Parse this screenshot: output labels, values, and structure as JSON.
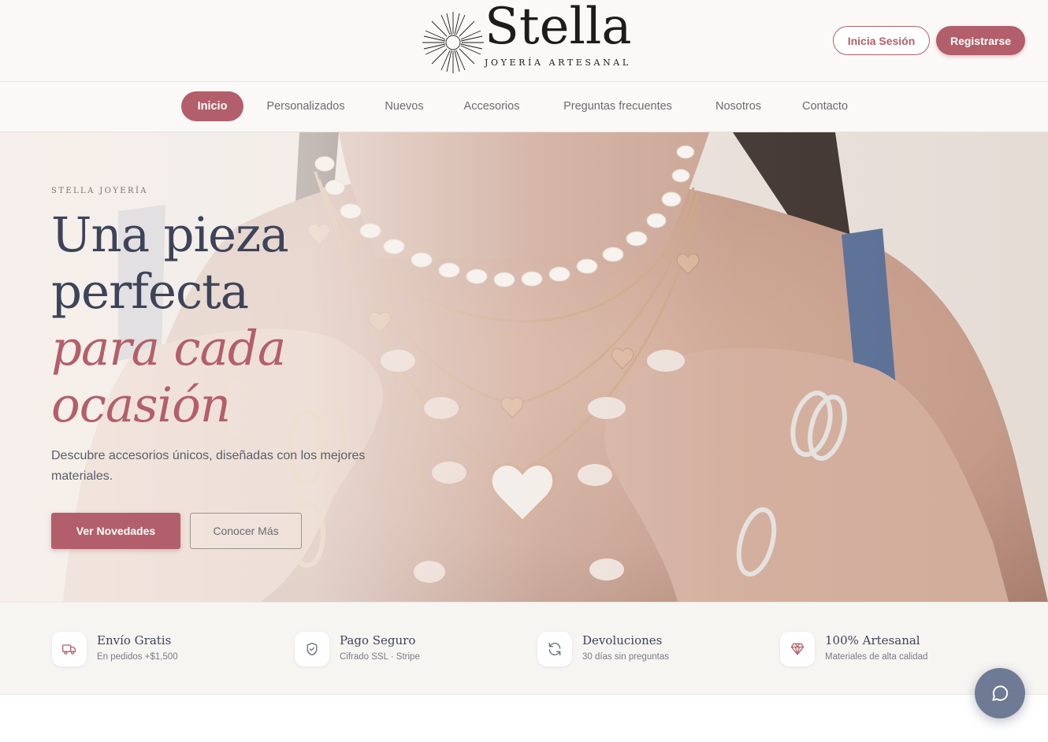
{
  "brand": {
    "name": "Stella",
    "tagline": "JOYERÍA ARTESANAL"
  },
  "header": {
    "login_label": "Inicia Sesión",
    "register_label": "Registrarse"
  },
  "nav": {
    "items": [
      {
        "label": "Inicio",
        "active": true
      },
      {
        "label": "Personalizados",
        "active": false
      },
      {
        "label": "Nuevos",
        "active": false
      },
      {
        "label": "Accesorios",
        "active": false
      },
      {
        "label": "Preguntas frecuentes",
        "active": false
      },
      {
        "label": "Nosotros",
        "active": false
      },
      {
        "label": "Contacto",
        "active": false
      }
    ]
  },
  "hero": {
    "eyebrow": "STELLA JOYERÍA",
    "headline_1": "Una pieza",
    "headline_2": "perfecta",
    "headline_accent_1": "para cada",
    "headline_accent_2": "ocasión",
    "description": "Descubre accesorios únicos, diseñadas con los mejores materiales.",
    "primary_cta": "Ver Novedades",
    "secondary_cta": "Conocer Más"
  },
  "features": [
    {
      "icon": "truck-icon",
      "title": "Envío Gratis",
      "subtitle": "En pedidos +$1,500"
    },
    {
      "icon": "shield-check-icon",
      "title": "Pago Seguro",
      "subtitle": "Cifrado SSL · Stripe"
    },
    {
      "icon": "refresh-icon",
      "title": "Devoluciones",
      "subtitle": "30 días sin preguntas"
    },
    {
      "icon": "diamond-icon",
      "title": "100% Artesanal",
      "subtitle": "Materiales de alta calidad"
    }
  ],
  "chat": {
    "icon": "chat-bubble-icon"
  },
  "colors": {
    "accent": "#b35f6b",
    "heading": "#3d4459",
    "background": "#faf9f7",
    "chat_button": "#6f7a94"
  }
}
